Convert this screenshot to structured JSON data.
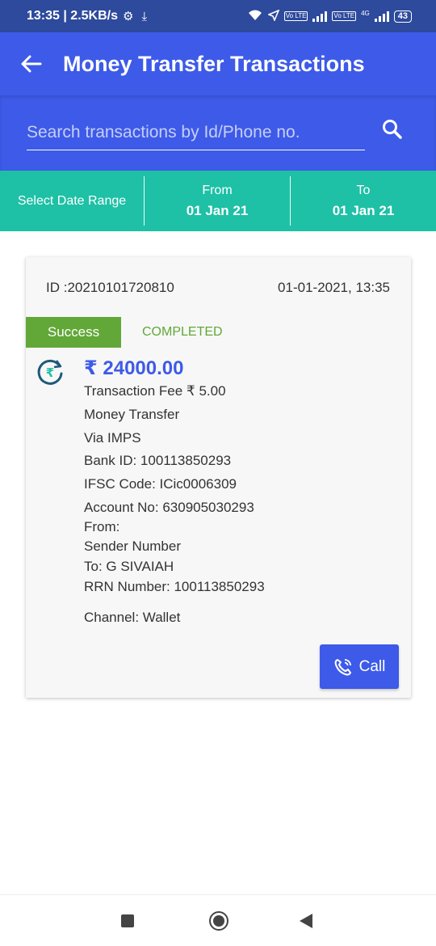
{
  "status": {
    "time": "13:35",
    "speed": "2.5KB/s",
    "network": "4G",
    "volte": "Vo LTE",
    "battery": "43"
  },
  "header": {
    "title": "Money Transfer Transactions",
    "back_icon": "arrow-left-icon"
  },
  "search": {
    "placeholder": "Search transactions by Id/Phone no.",
    "value": "",
    "icon": "search-icon"
  },
  "date_range": {
    "label": "Select Date Range",
    "from_label": "From",
    "from_value": "01 Jan 21",
    "to_label": "To",
    "to_value": "01 Jan 21"
  },
  "transaction": {
    "id": "ID :20210101720810",
    "datetime": "01-01-2021, 13:35",
    "status_badge": "Success",
    "status_text": "COMPLETED",
    "amount": "₹ 24000.00",
    "fee": "Transaction Fee ₹ 5.00",
    "type": "Money Transfer",
    "via": "Via IMPS",
    "bank_id": "Bank ID: 100113850293",
    "ifsc": "IFSC Code: ICic0006309",
    "account": "Account No: 630905030293",
    "from": "From:",
    "sender": "Sender Number",
    "to": "To: G SIVAIAH",
    "rrn": "RRN Number: 100113850293",
    "channel": "Channel: Wallet",
    "call_label": "Call"
  },
  "colors": {
    "primary": "#3d5ae8",
    "status_bar": "#2d4a9c",
    "teal": "#1ec0a6",
    "success": "#62a838"
  }
}
